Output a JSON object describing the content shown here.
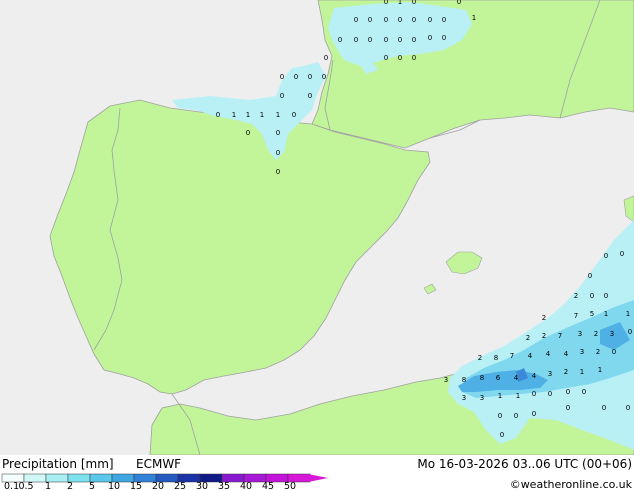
{
  "legend": {
    "title": "Precipitation [mm]",
    "model": "ECMWF",
    "valid_time": "Mo 16-03-2026 03..06 UTC (00+06)",
    "credit": "©weatheronline.co.uk",
    "scale_labels": [
      "0.1",
      "0.5",
      "1",
      "2",
      "5",
      "10",
      "15",
      "20",
      "25",
      "30",
      "35",
      "40",
      "45",
      "50"
    ],
    "scale_colors": [
      "#f5fefe",
      "#d2f7f7",
      "#a8eff4",
      "#7ee2ee",
      "#5ac8ea",
      "#3ea6e2",
      "#2f82d8",
      "#2459c2",
      "#1a33a6",
      "#101a86",
      "#8a1ad2",
      "#a818d8",
      "#c414dc",
      "#d818d8"
    ]
  },
  "colors": {
    "sea": "#eeeeee",
    "land": "#c2f59a",
    "border": "#a0a0a0",
    "rain_light": "#b9f0f6",
    "rain_mid": "#7fd8ee",
    "rain_heavy": "#4fb0e6",
    "rain_core": "#3a8ad8"
  },
  "map_values": [
    {
      "id": "v1",
      "text": "0"
    },
    {
      "id": "v2",
      "text": "1"
    },
    {
      "id": "v3",
      "text": "0"
    },
    {
      "id": "v4",
      "text": "0"
    },
    {
      "id": "v5",
      "text": "0"
    },
    {
      "id": "v6",
      "text": "0"
    },
    {
      "id": "v7",
      "text": "0"
    },
    {
      "id": "v8",
      "text": "0"
    },
    {
      "id": "v9",
      "text": "0"
    },
    {
      "id": "v10",
      "text": "0"
    },
    {
      "id": "v11",
      "text": "0"
    },
    {
      "id": "v12",
      "text": "1"
    },
    {
      "id": "v13",
      "text": "0"
    },
    {
      "id": "v14",
      "text": "0"
    },
    {
      "id": "v15",
      "text": "0"
    },
    {
      "id": "v16",
      "text": "0"
    },
    {
      "id": "v17",
      "text": "0"
    },
    {
      "id": "v18",
      "text": "0"
    },
    {
      "id": "v19",
      "text": "0"
    },
    {
      "id": "v20",
      "text": "0"
    },
    {
      "id": "v21",
      "text": "0"
    },
    {
      "id": "v22",
      "text": "0"
    },
    {
      "id": "v23",
      "text": "0"
    },
    {
      "id": "v24",
      "text": "0"
    },
    {
      "id": "v25",
      "text": "0"
    },
    {
      "id": "v26",
      "text": "0"
    },
    {
      "id": "v27",
      "text": "0"
    },
    {
      "id": "v28",
      "text": "0"
    },
    {
      "id": "v29",
      "text": "0"
    },
    {
      "id": "v30",
      "text": "1"
    },
    {
      "id": "v31",
      "text": "1"
    },
    {
      "id": "v32",
      "text": "1"
    },
    {
      "id": "v33",
      "text": "1"
    },
    {
      "id": "v34",
      "text": "0"
    },
    {
      "id": "v35",
      "text": "0"
    },
    {
      "id": "v36",
      "text": "0"
    },
    {
      "id": "v37",
      "text": "0"
    },
    {
      "id": "v38",
      "text": "0"
    },
    {
      "id": "v39",
      "text": "0"
    },
    {
      "id": "v40",
      "text": "0"
    },
    {
      "id": "v41",
      "text": "0"
    },
    {
      "id": "v42",
      "text": "0"
    },
    {
      "id": "v43",
      "text": "0"
    },
    {
      "id": "v44",
      "text": "2"
    },
    {
      "id": "v45",
      "text": "0"
    },
    {
      "id": "v46",
      "text": "0"
    },
    {
      "id": "v47",
      "text": "2"
    },
    {
      "id": "v48",
      "text": "7"
    },
    {
      "id": "v49",
      "text": "5"
    },
    {
      "id": "v50",
      "text": "1"
    },
    {
      "id": "v51",
      "text": "1"
    },
    {
      "id": "v52",
      "text": "2"
    },
    {
      "id": "v53",
      "text": "2"
    },
    {
      "id": "v54",
      "text": "7"
    },
    {
      "id": "v55",
      "text": "3"
    },
    {
      "id": "v56",
      "text": "2"
    },
    {
      "id": "v57",
      "text": "3"
    },
    {
      "id": "v58",
      "text": "0"
    },
    {
      "id": "v59",
      "text": "2"
    },
    {
      "id": "v60",
      "text": "8"
    },
    {
      "id": "v61",
      "text": "7"
    },
    {
      "id": "v62",
      "text": "4"
    },
    {
      "id": "v63",
      "text": "4"
    },
    {
      "id": "v64",
      "text": "4"
    },
    {
      "id": "v65",
      "text": "3"
    },
    {
      "id": "v66",
      "text": "2"
    },
    {
      "id": "v67",
      "text": "0"
    },
    {
      "id": "v68",
      "text": "3"
    },
    {
      "id": "v69",
      "text": "8"
    },
    {
      "id": "v70",
      "text": "8"
    },
    {
      "id": "v71",
      "text": "6"
    },
    {
      "id": "v72",
      "text": "4"
    },
    {
      "id": "v73",
      "text": "4"
    },
    {
      "id": "v74",
      "text": "3"
    },
    {
      "id": "v75",
      "text": "2"
    },
    {
      "id": "v76",
      "text": "1"
    },
    {
      "id": "v77",
      "text": "1"
    },
    {
      "id": "v78",
      "text": "3"
    },
    {
      "id": "v79",
      "text": "3"
    },
    {
      "id": "v80",
      "text": "1"
    },
    {
      "id": "v81",
      "text": "1"
    },
    {
      "id": "v82",
      "text": "0"
    },
    {
      "id": "v83",
      "text": "0"
    },
    {
      "id": "v84",
      "text": "0"
    },
    {
      "id": "v85",
      "text": "0"
    },
    {
      "id": "v86",
      "text": "0"
    },
    {
      "id": "v87",
      "text": "0"
    },
    {
      "id": "v88",
      "text": "0"
    },
    {
      "id": "v89",
      "text": "0"
    },
    {
      "id": "v90",
      "text": "0"
    },
    {
      "id": "v91",
      "text": "0"
    },
    {
      "id": "v92",
      "text": "0"
    }
  ]
}
